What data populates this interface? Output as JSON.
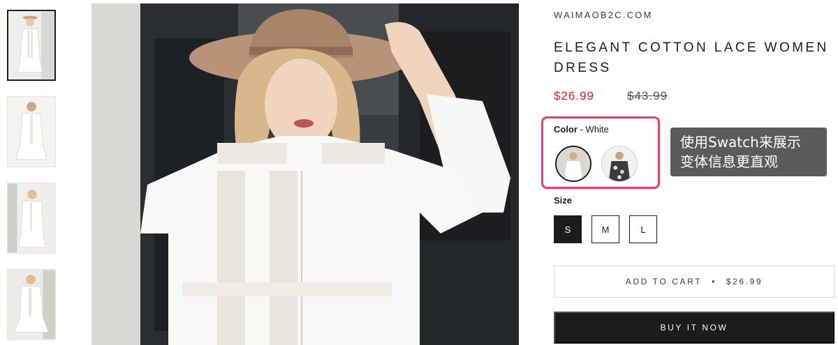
{
  "gallery": {
    "thumbnails": [
      {
        "alt": "thumbnail-1",
        "active": true
      },
      {
        "alt": "thumbnail-2",
        "active": false
      },
      {
        "alt": "thumbnail-3",
        "active": false
      },
      {
        "alt": "thumbnail-4",
        "active": false
      }
    ]
  },
  "product": {
    "vendor": "WAIMAOB2C.COM",
    "title": "ELEGANT COTTON LACE WOMEN DRESS",
    "price": "$26.99",
    "compare_price": "$43.99"
  },
  "color_option": {
    "label": "Color",
    "separator": " - ",
    "value": "White",
    "swatches": [
      {
        "name": "White",
        "selected": true
      },
      {
        "name": "Floral",
        "selected": false
      }
    ]
  },
  "callout": {
    "line1": "使用Swatch来展示",
    "line2": "变体信息更直观"
  },
  "size_option": {
    "label": "Size",
    "options": [
      {
        "label": "S",
        "selected": true
      },
      {
        "label": "M",
        "selected": false
      },
      {
        "label": "L",
        "selected": false
      }
    ]
  },
  "actions": {
    "add_to_cart_label": "ADD TO CART",
    "dot": "•",
    "add_to_cart_price": "$26.99",
    "buy_now_label": "BUY IT NOW"
  },
  "colors": {
    "price_red": "#e22120",
    "highlight_pink": "#f0387a",
    "button_dark": "#1c1c1c",
    "callout_gray": "#5b5b5b"
  }
}
